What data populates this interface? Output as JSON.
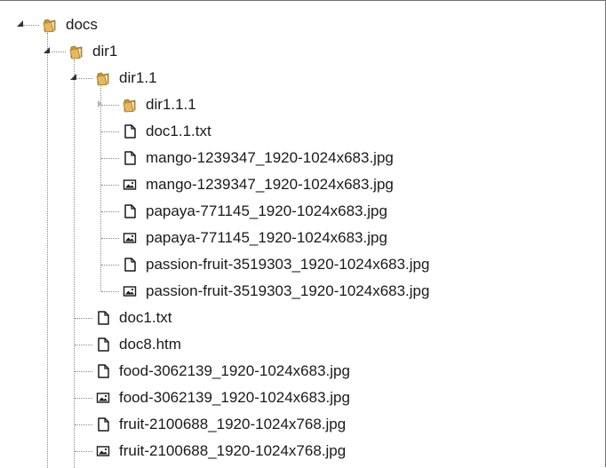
{
  "tree": {
    "nodes": [
      {
        "label": "docs",
        "type": "folder",
        "depth": 0,
        "expander": "expanded"
      },
      {
        "label": "dir1",
        "type": "folder",
        "depth": 1,
        "expander": "expanded"
      },
      {
        "label": "dir1.1",
        "type": "folder",
        "depth": 2,
        "expander": "expanded"
      },
      {
        "label": "dir1.1.1",
        "type": "folder",
        "depth": 3,
        "expander": "collapsed"
      },
      {
        "label": "doc1.1.txt",
        "type": "file",
        "depth": 3,
        "expander": "none"
      },
      {
        "label": "mango-1239347_1920-1024x683.jpg",
        "type": "file",
        "depth": 3,
        "expander": "none"
      },
      {
        "label": "mango-1239347_1920-1024x683.jpg",
        "type": "image",
        "depth": 3,
        "expander": "none"
      },
      {
        "label": "papaya-771145_1920-1024x683.jpg",
        "type": "file",
        "depth": 3,
        "expander": "none"
      },
      {
        "label": "papaya-771145_1920-1024x683.jpg",
        "type": "image",
        "depth": 3,
        "expander": "none"
      },
      {
        "label": "passion-fruit-3519303_1920-1024x683.jpg",
        "type": "file",
        "depth": 3,
        "expander": "none"
      },
      {
        "label": "passion-fruit-3519303_1920-1024x683.jpg",
        "type": "image",
        "depth": 3,
        "expander": "none"
      },
      {
        "label": "doc1.txt",
        "type": "file",
        "depth": 2,
        "expander": "none"
      },
      {
        "label": "doc8.htm",
        "type": "file",
        "depth": 2,
        "expander": "none"
      },
      {
        "label": "food-3062139_1920-1024x683.jpg",
        "type": "file",
        "depth": 2,
        "expander": "none"
      },
      {
        "label": "food-3062139_1920-1024x683.jpg",
        "type": "image",
        "depth": 2,
        "expander": "none"
      },
      {
        "label": "fruit-2100688_1920-1024x768.jpg",
        "type": "file",
        "depth": 2,
        "expander": "none"
      },
      {
        "label": "fruit-2100688_1920-1024x768.jpg",
        "type": "image",
        "depth": 2,
        "expander": "none"
      }
    ]
  },
  "icons": {
    "folder": "folder-icon",
    "file": "file-icon",
    "image": "image-file-icon"
  },
  "colors": {
    "folder_fill": "#e8b85a",
    "folder_dark": "#c9962d",
    "icon_stroke": "#1a1a1a",
    "connector": "#8a8a8a",
    "text": "#1a1a1a"
  }
}
